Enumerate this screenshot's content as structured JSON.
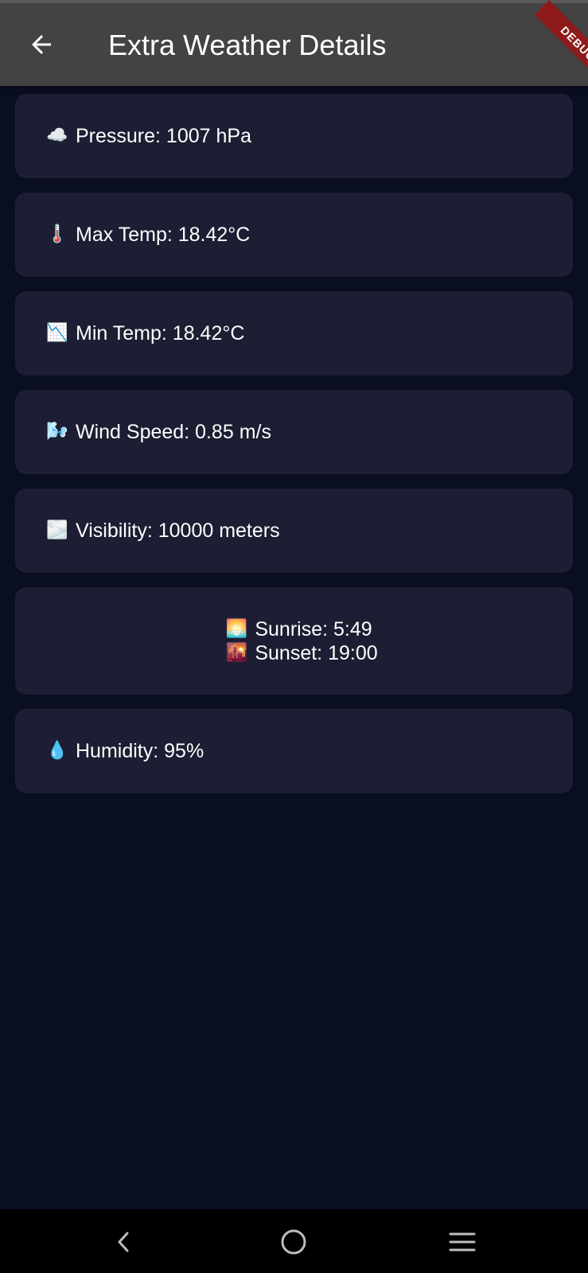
{
  "app_bar": {
    "title": "Extra Weather Details",
    "back_icon": "arrow-left-icon"
  },
  "debug_banner": {
    "label": "DEBUG"
  },
  "colors": {
    "background": "#0a0e21",
    "card": "#1d1e33",
    "app_bar": "#434343",
    "debug_ribbon": "#8e1b1b"
  },
  "details": {
    "pressure": {
      "icon": "☁️",
      "text": "Pressure: 1007 hPa"
    },
    "max_temp": {
      "icon": "🌡️",
      "text": "Max Temp: 18.42°C"
    },
    "min_temp": {
      "icon": "📉",
      "text": "Min Temp: 18.42°C"
    },
    "wind_speed": {
      "icon": "🌬️",
      "text": "Wind Speed: 0.85 m/s"
    },
    "visibility": {
      "icon": "🌫️",
      "text": "Visibility: 10000 meters"
    },
    "sunrise": {
      "icon": "🌅",
      "text": "Sunrise: 5:49"
    },
    "sunset": {
      "icon": "🌇",
      "text": "Sunset: 19:00"
    },
    "humidity": {
      "icon": "💧",
      "text": "Humidity: 95%"
    }
  },
  "system_nav": {
    "back_icon": "nav-back-icon",
    "home_icon": "nav-home-icon",
    "menu_icon": "nav-menu-icon"
  }
}
